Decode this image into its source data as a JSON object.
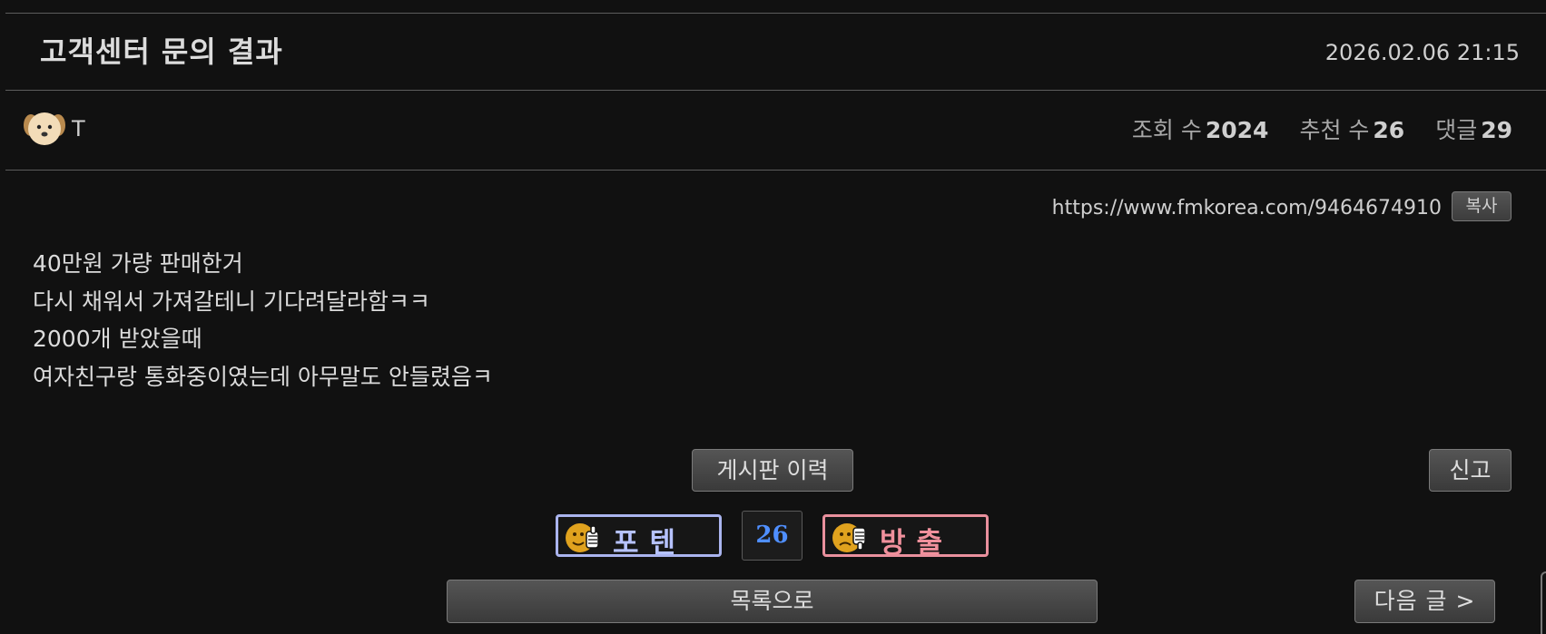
{
  "post": {
    "title": "고객센터 문의 결과",
    "date": "2026.02.06 21:15",
    "author": "T",
    "stats": {
      "views_label": "조회 수",
      "views": "2024",
      "likes_label": "추천 수",
      "likes": "26",
      "comments_label": "댓글",
      "comments": "29"
    },
    "url": "https://www.fmkorea.com/9464674910",
    "copy_label": "복사",
    "content": [
      "40만원 가량 판매한거",
      "다시 채워서 가져갈테니 기다려달라함ㅋㅋ",
      "2000개 받았을때",
      "여자친구랑 통화중이였는데 아무말도 안들렸음ㅋ"
    ]
  },
  "actions": {
    "board_history": "게시판 이력",
    "report": "신고",
    "vote_up": "포텐",
    "vote_count": "26",
    "vote_down": "방출",
    "list": "목록으로",
    "next": "다음 글 >"
  },
  "icons": {
    "avatar": "puppy-avatar-icon",
    "vote_up": "thumbs-up-face-icon",
    "vote_down": "thumbs-down-face-icon"
  },
  "colors": {
    "background": "#111111",
    "vote_up_border": "#aab4ee",
    "vote_down_border": "#e9909d",
    "vote_count": "#4f8fff"
  }
}
